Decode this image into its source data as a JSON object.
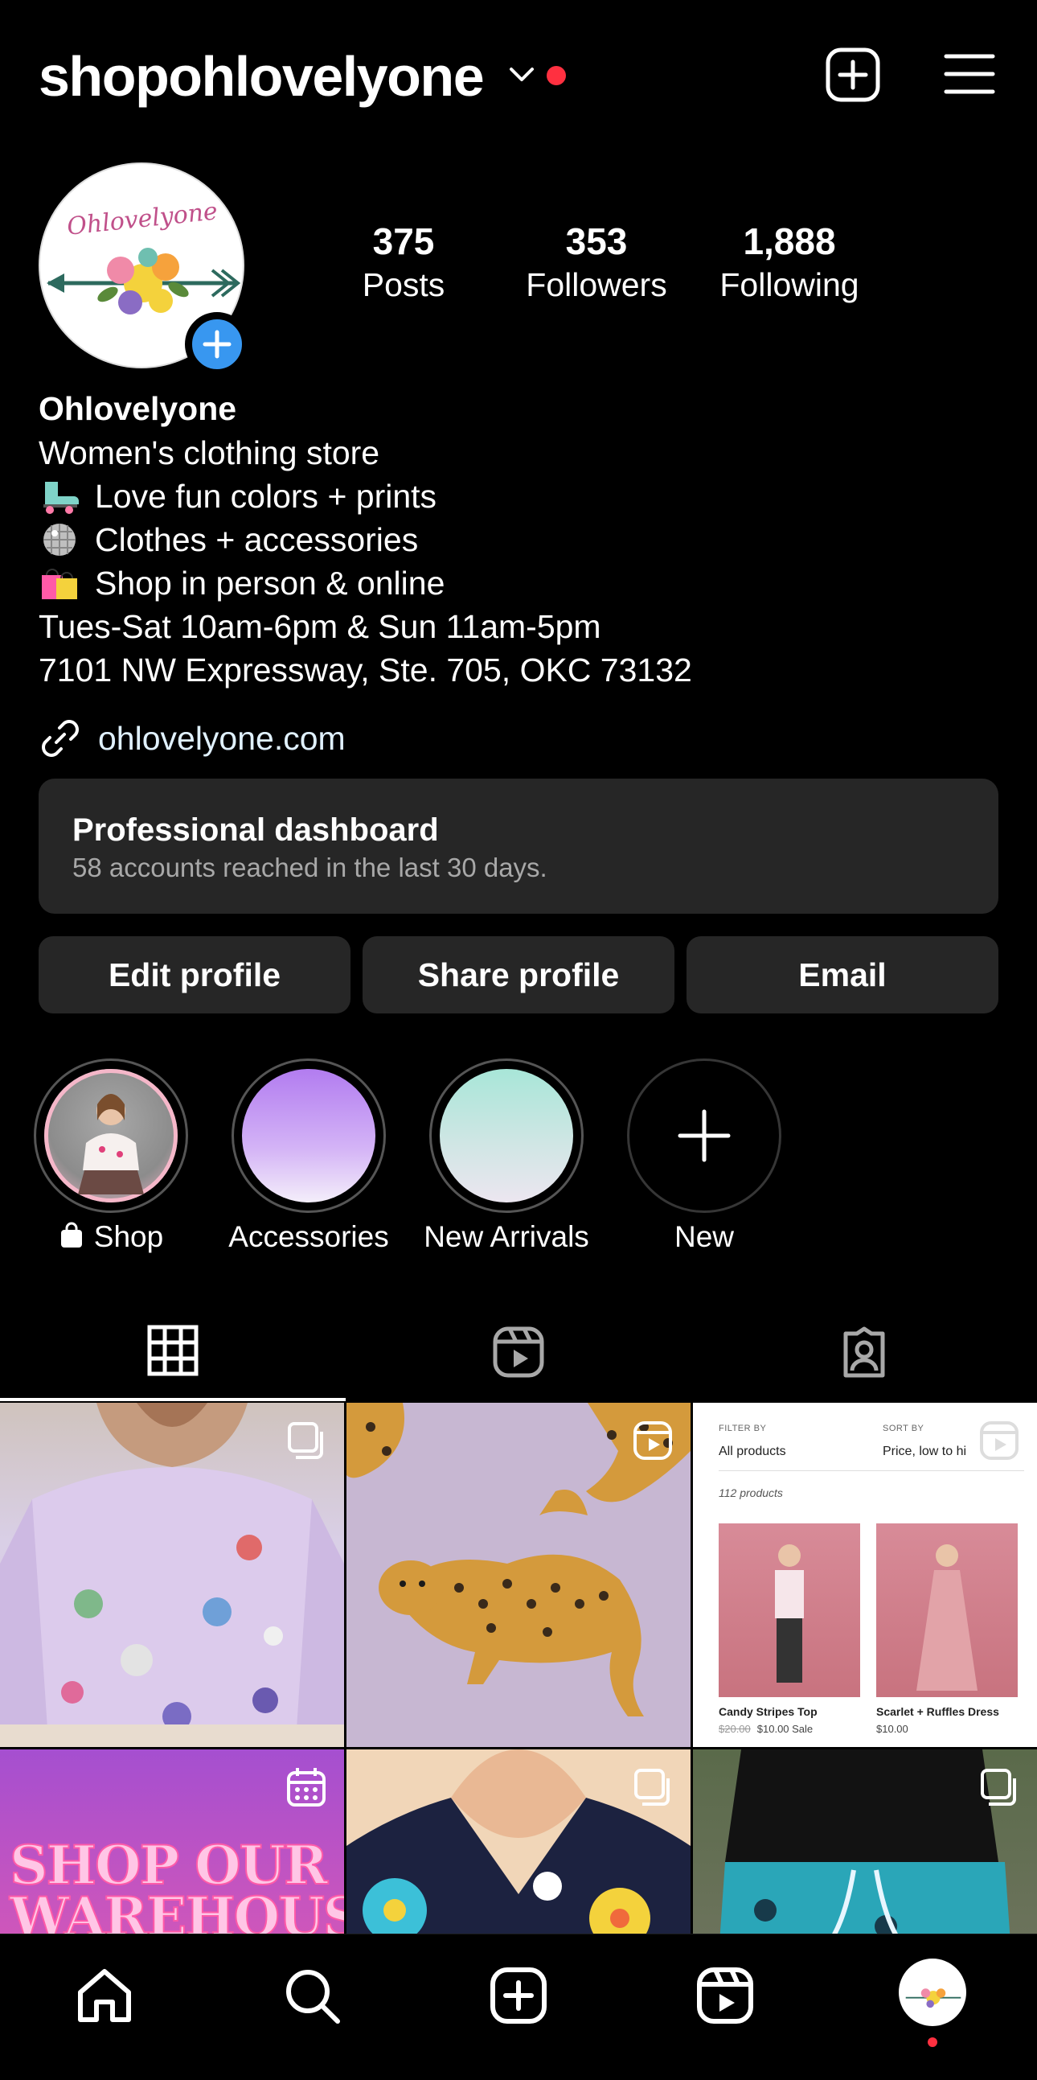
{
  "header": {
    "username": "shopohlovelyone"
  },
  "profile": {
    "display_name": "Ohlovelyone",
    "stats": [
      {
        "value": "375",
        "label": "Posts"
      },
      {
        "value": "353",
        "label": "Followers"
      },
      {
        "value": "1,888",
        "label": "Following"
      }
    ],
    "bio": {
      "category": "Women's clothing store",
      "lines": [
        {
          "emoji": "roller-skate",
          "text": "Love fun colors + prints"
        },
        {
          "emoji": "disco-ball",
          "text": "Clothes + accessories"
        },
        {
          "emoji": "shopping-bags",
          "text": "Shop in person & online"
        }
      ],
      "hours": "Tues-Sat 10am-6pm & Sun 11am-5pm",
      "address": "7101 NW Expressway, Ste. 705, OKC 73132"
    },
    "website": "ohlovelyone.com",
    "logo_text": "Ohlovelyone"
  },
  "dashboard": {
    "title": "Professional dashboard",
    "subtitle": "58 accounts reached in the last 30 days."
  },
  "buttons": {
    "edit": "Edit profile",
    "share": "Share profile",
    "email": "Email"
  },
  "highlights": [
    {
      "label": "Shop",
      "icon": "shopping-bag-icon"
    },
    {
      "label": "Accessories"
    },
    {
      "label": "New Arrivals"
    },
    {
      "label": "New",
      "icon": "plus-icon"
    }
  ],
  "tabs": [
    {
      "name": "posts-grid",
      "icon": "grid-icon",
      "active": true
    },
    {
      "name": "reels",
      "icon": "reels-icon",
      "active": false
    },
    {
      "name": "tagged",
      "icon": "tagged-icon",
      "active": false
    }
  ],
  "posts": {
    "shop_screenshot": {
      "filter_label": "FILTER BY",
      "filter_value": "All products",
      "sort_label": "SORT BY",
      "sort_value": "Price, low to hi",
      "count": "112 products",
      "products": [
        {
          "name": "Candy Stripes Top",
          "old_price": "$20.00",
          "price": "$10.00 Sale"
        },
        {
          "name": "Scarlet + Ruffles Dress",
          "price": "$10.00"
        }
      ]
    },
    "warehouse_text": [
      "SHOP OUR",
      "WAREHOUSE"
    ]
  },
  "colors": {
    "background": "#000000",
    "button_bg": "#262626",
    "accent_blue": "#3897f0",
    "notification_red": "#ff3040",
    "muted_text": "#a8a8a8"
  }
}
